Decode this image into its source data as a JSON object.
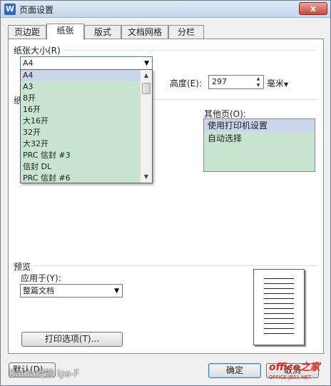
{
  "window": {
    "title": "页面设置",
    "close_label": "x",
    "app_icon": "W"
  },
  "tabs": [
    "页边距",
    "纸张",
    "版式",
    "文档网格",
    "分栏"
  ],
  "paper_size": {
    "group_label": "纸张大小(R)",
    "selected": "A4",
    "dropdown_items": [
      "A4",
      "A3",
      "8开",
      "16开",
      "大16开",
      "32开",
      "大32开",
      "PRC 信封 #3",
      "信封 DL",
      "PRC 信封 #6"
    ],
    "height_label": "高度(E):",
    "height_value": "297",
    "unit": "毫米",
    "hidden_group_label": "纸"
  },
  "other_pages": {
    "label": "其他页(O):",
    "items": [
      "使用打印机设置",
      "自动选择"
    ]
  },
  "preview": {
    "group_label": "预览",
    "apply_label": "应用于(Y):",
    "apply_value": "整篇文档"
  },
  "buttons": {
    "print_options": "打印选项(T)...",
    "default": "默认(D)...",
    "ok": "确定",
    "cancel": "取消"
  },
  "watermarks": {
    "left": "Baidu经验 lps-F",
    "right_main": "office之家",
    "right_sub": "OFFICE.JB51.NET"
  },
  "colors": {
    "list_bg": "#c8e6cf",
    "selection": "#c9d6ec",
    "accent": "#2d68c4"
  }
}
